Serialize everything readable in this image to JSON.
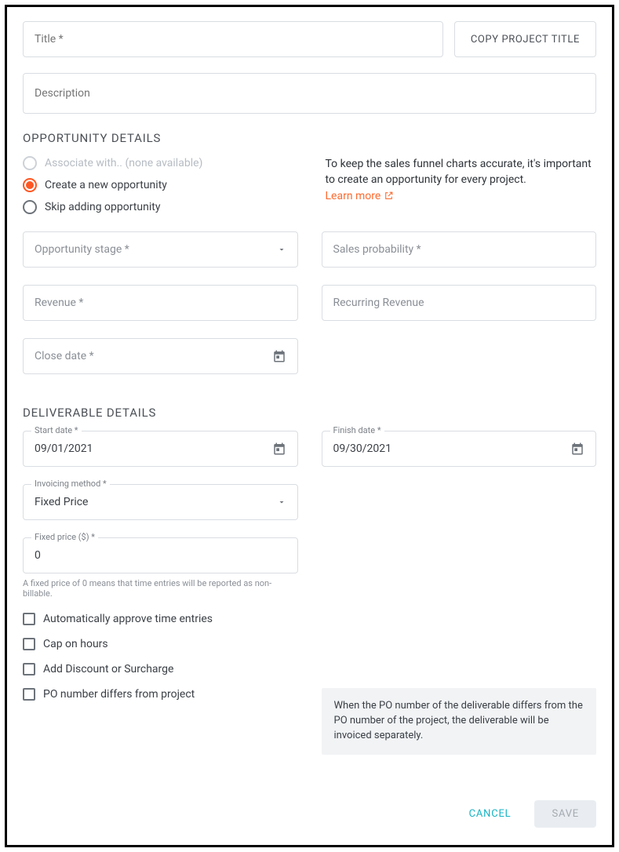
{
  "header": {
    "title_placeholder": "Title *",
    "copy_button": "COPY PROJECT TITLE",
    "description_placeholder": "Description"
  },
  "opportunity": {
    "section_title": "OPPORTUNITY DETAILS",
    "radios": {
      "associate": "Associate with.. (none available)",
      "create": "Create a new opportunity",
      "skip": "Skip adding opportunity"
    },
    "info_text": "To keep the sales funnel charts accurate, it's important to create an opportunity for every project.",
    "learn_more": "Learn more",
    "fields": {
      "stage": "Opportunity stage *",
      "sales_prob": "Sales probability *",
      "revenue": "Revenue *",
      "recurring": "Recurring Revenue",
      "close_date": "Close date *"
    }
  },
  "deliverable": {
    "section_title": "DELIVERABLE DETAILS",
    "start_date": {
      "label": "Start date *",
      "value": "09/01/2021"
    },
    "finish_date": {
      "label": "Finish date *",
      "value": "09/30/2021"
    },
    "invoicing": {
      "label": "Invoicing method *",
      "value": "Fixed Price"
    },
    "fixed_price": {
      "label": "Fixed price ($) *",
      "value": "0",
      "helper": "A fixed price of 0 means that time entries will be reported as non-billable."
    },
    "checkboxes": {
      "auto_approve": "Automatically approve time entries",
      "cap_hours": "Cap on hours",
      "discount": "Add Discount or Surcharge",
      "po_number": "PO number differs from project"
    },
    "po_tooltip": "When the PO number of the deliverable differs from the PO number of the project, the deliverable will be invoiced separately."
  },
  "footer": {
    "cancel": "CANCEL",
    "save": "SAVE"
  }
}
